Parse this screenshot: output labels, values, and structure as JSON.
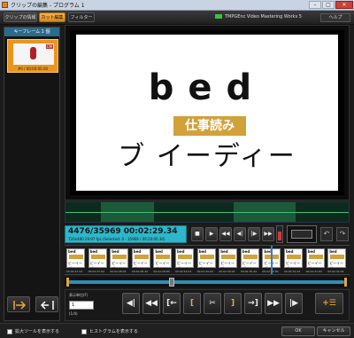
{
  "window": {
    "title": "クリップの編集 - プログラム 1"
  },
  "titlebar_buttons": {
    "minimize": "–",
    "maximize": "□",
    "close": "✕"
  },
  "tabs": [
    {
      "label": "クリップの情報",
      "active": false
    },
    {
      "label": "カット編集",
      "active": true
    },
    {
      "label": "フィルター",
      "active": false
    }
  ],
  "brand": {
    "name": "TMPGEnc Video Mastering Works 5"
  },
  "help": {
    "label": "ヘルプ"
  },
  "keyframes": {
    "header": "キーフレーム 1 個",
    "items": [
      {
        "caption": "#0 / 00:00:00.00",
        "badge": "CM"
      }
    ]
  },
  "preview": {
    "word": "bed",
    "tag": "仕事読み",
    "line": "ブ イーディー"
  },
  "timecode": {
    "main": "4476/35969  00:02:29.34",
    "sub": "720x480 29.97 fps (Selected: 0 - 35969 / 00:20:00.30)"
  },
  "transport": [
    "■",
    "▶",
    "◀◀",
    "◀|",
    "|▶",
    "▶▶",
    "⊙"
  ],
  "undo": {
    "undo": "↶",
    "redo": "↷"
  },
  "filmstrip": {
    "frames": [
      {
        "word": "bed",
        "code": "00:02:27.24"
      },
      {
        "word": "bed",
        "code": "00:02:27.64"
      },
      {
        "word": "bed",
        "code": "00:02:28.04"
      },
      {
        "word": "bed",
        "code": "00:02:28.44"
      },
      {
        "word": "bed",
        "code": "00:02:28.84"
      },
      {
        "word": "bed",
        "code": "00:02:29.24"
      },
      {
        "word": "bed",
        "code": "00:02:29.64"
      },
      {
        "word": "bed",
        "code": "00:02:30.04"
      },
      {
        "word": "bed",
        "code": "00:02:30.44"
      },
      {
        "word": "bed",
        "code": "00:02:30.84"
      },
      {
        "word": "bed",
        "code": "00:02:31.24"
      },
      {
        "word": "bed",
        "code": "00:02:31.64"
      },
      {
        "word": "bed",
        "code": "00:02:32.04"
      }
    ],
    "frame_sub": "ビーイーディー"
  },
  "edit": {
    "step_label": "表示単位(F)",
    "step_value": "1",
    "step_unit": "(1/4)",
    "buttons": [
      "◀|",
      "◀◀",
      "[←",
      "[",
      "✂",
      "]",
      "→]",
      "▶▶",
      "|▶",
      "+☰"
    ]
  },
  "footer": {
    "check1": "拡大ツールを表示する",
    "check2": "ヒストグラムを表示する",
    "ok": "OK",
    "cancel": "キャンセル"
  }
}
